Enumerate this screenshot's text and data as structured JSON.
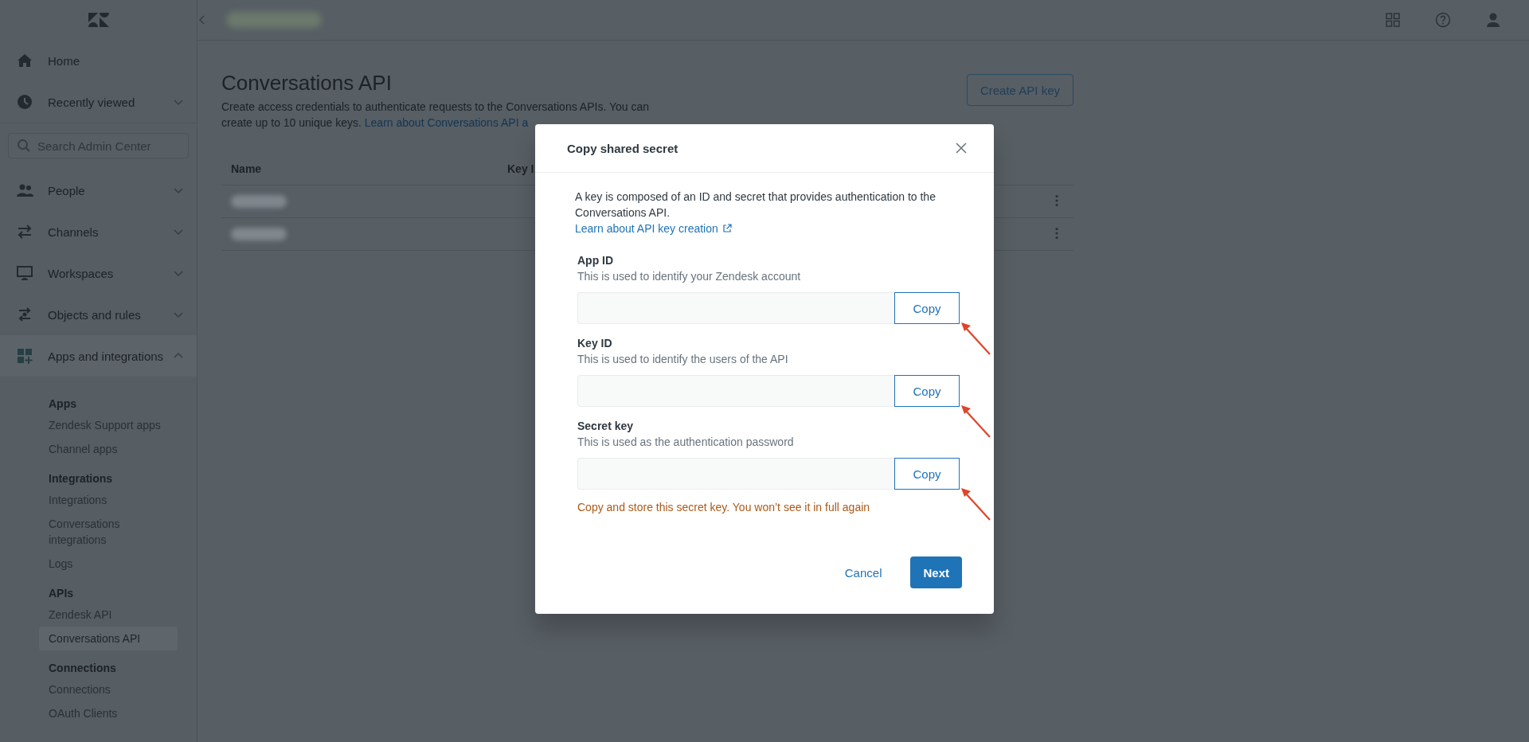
{
  "sidebar": {
    "items": [
      {
        "label": "Home",
        "kind": "home",
        "expandable": false
      },
      {
        "label": "Recently viewed",
        "kind": "clock",
        "expandable": true,
        "expanded": false
      }
    ],
    "search": {
      "placeholder": "Search Admin Center"
    },
    "sections": [
      {
        "label": "People",
        "kind": "people",
        "expanded": false
      },
      {
        "label": "Channels",
        "kind": "arrows",
        "expanded": false
      },
      {
        "label": "Workspaces",
        "kind": "monitor",
        "expanded": false
      },
      {
        "label": "Objects and rules",
        "kind": "rules",
        "expanded": false
      },
      {
        "label": "Apps and integrations",
        "kind": "apps",
        "expanded": true,
        "groups": [
          {
            "heading": "Apps",
            "links": [
              {
                "label": "Zendesk Support apps",
                "selected": false
              },
              {
                "label": "Channel apps",
                "selected": false
              }
            ]
          },
          {
            "heading": "Integrations",
            "links": [
              {
                "label": "Integrations",
                "selected": false
              },
              {
                "label": "Conversations integrations",
                "selected": false
              },
              {
                "label": "Logs",
                "selected": false
              }
            ]
          },
          {
            "heading": "APIs",
            "links": [
              {
                "label": "Zendesk API",
                "selected": false
              },
              {
                "label": "Conversations API",
                "selected": true
              }
            ]
          },
          {
            "heading": "Connections",
            "links": [
              {
                "label": "Connections",
                "selected": false
              },
              {
                "label": "OAuth Clients",
                "selected": false
              }
            ]
          }
        ]
      }
    ]
  },
  "page": {
    "title": "Conversations API",
    "description": "Create access credentials to authenticate requests to the Conversations APIs. You can create up to 10 unique keys.",
    "link": "Learn about Conversations API a",
    "create_button": "Create API key",
    "table": {
      "columns": [
        "Name",
        "Key I"
      ],
      "rows": [
        {
          "blurred": true
        },
        {
          "blurred": true
        }
      ]
    }
  },
  "dialog": {
    "title": "Copy shared secret",
    "intro": "A key is composed of an ID and secret that provides authentication to the Conversations API.",
    "link": "Learn about API key creation",
    "fields": [
      {
        "label": "App ID",
        "hint": "This is used to identify your Zendesk account",
        "button": "Copy",
        "marked": true
      },
      {
        "label": "Key ID",
        "hint": "This is used to identify the users of the API",
        "button": "Copy",
        "marked": true
      },
      {
        "label": "Secret key",
        "hint": "This is used as the authentication password",
        "button": "Copy",
        "marked": true
      }
    ],
    "warning": "Copy and store this secret key. You won’t see it in full again",
    "buttons": [
      {
        "label": "Cancel",
        "kind": "basic"
      },
      {
        "label": "Next",
        "kind": "primary"
      }
    ]
  }
}
